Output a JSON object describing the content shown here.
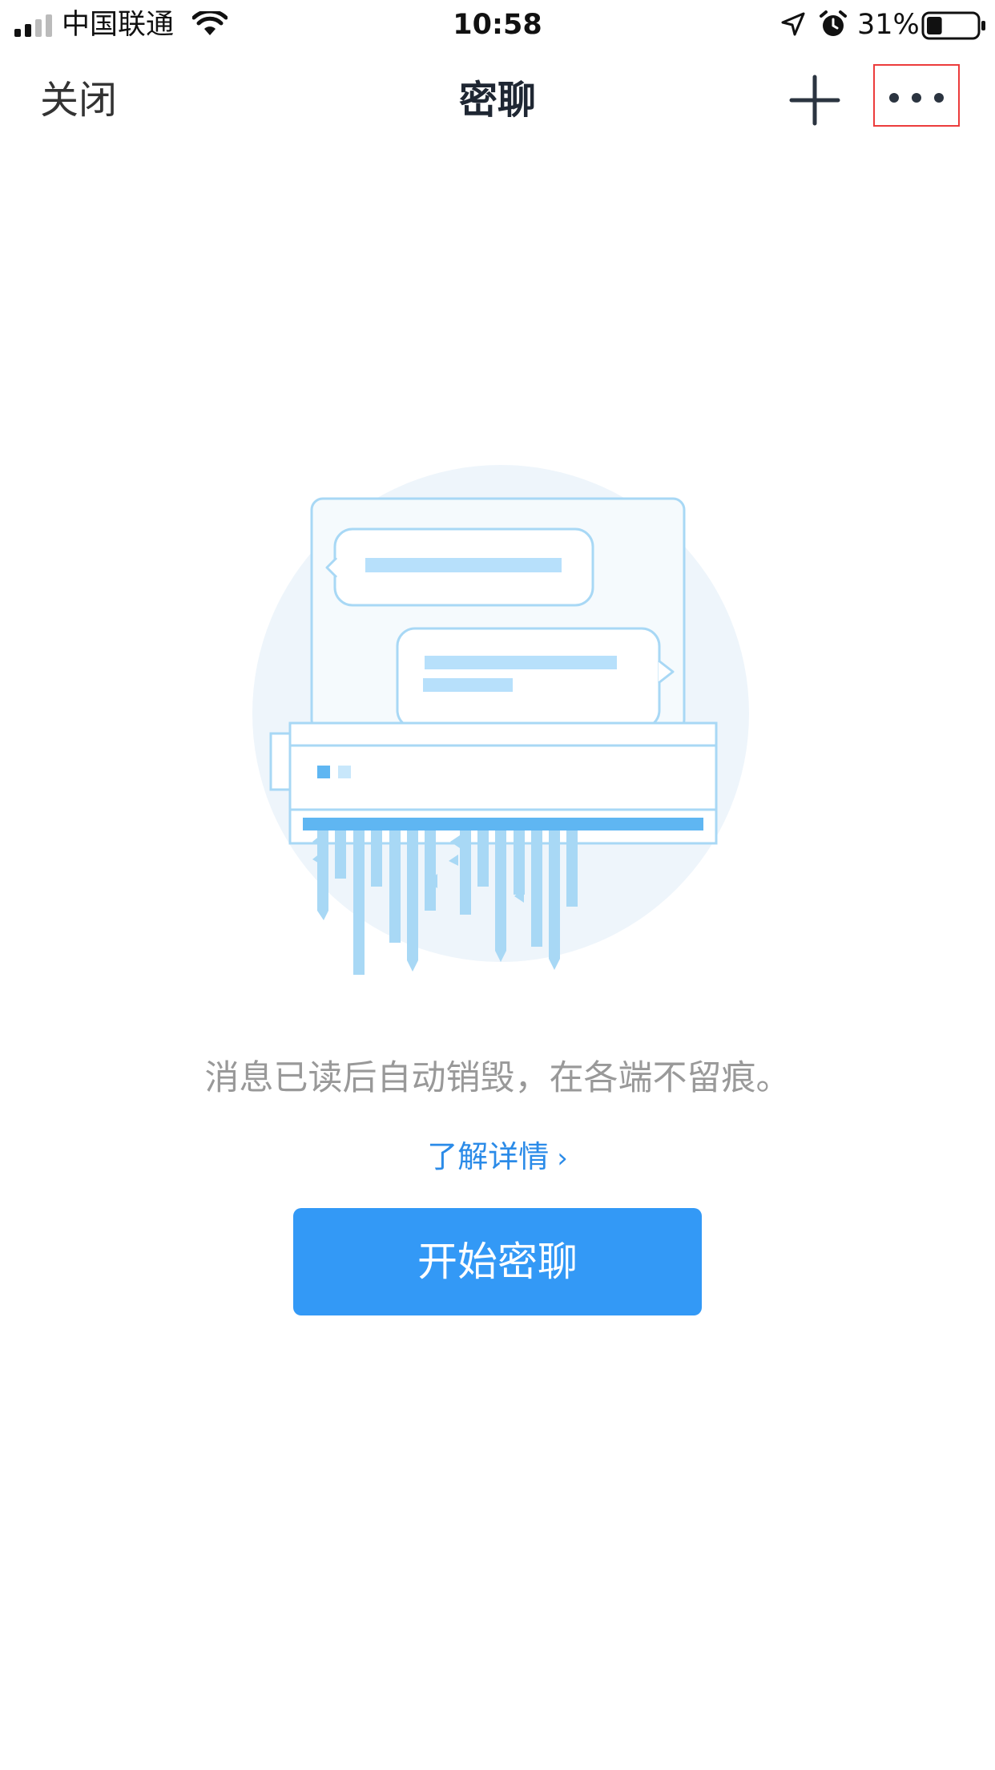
{
  "status_bar": {
    "carrier": "中国联通",
    "time": "10:58",
    "battery_percent": "31%",
    "battery_level": 0.31,
    "signal_bars": 2,
    "icons": [
      "signal-icon",
      "wifi-icon",
      "location-arrow-icon",
      "alarm-clock-icon",
      "battery-icon"
    ]
  },
  "nav": {
    "close_label": "关闭",
    "title": "密聊",
    "add_icon": "plus-icon",
    "more_icon": "more-dots-icon"
  },
  "content": {
    "illustration": "message-shredder-illustration",
    "description": "消息已读后自动销毁，在各端不留痕。",
    "learn_more": "了解详情",
    "learn_more_chevron": "›",
    "start_button": "开始密聊"
  },
  "colors": {
    "accent": "#3399f6",
    "link": "#2b8be8",
    "muted_text": "#999999",
    "highlight_box": "#ec3c3c",
    "illustration_stroke": "#a8d8f5",
    "illustration_fill": "#eef5fb"
  }
}
